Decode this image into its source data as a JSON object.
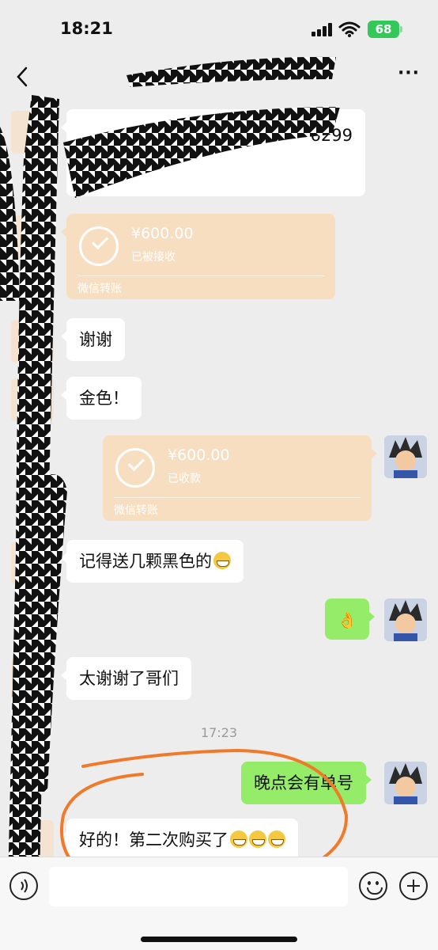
{
  "status_bar": {
    "time": "18:21",
    "battery": "68"
  },
  "nav": {
    "title": ""
  },
  "messages": [
    {
      "id": "m1",
      "dir": "in",
      "kind": "text",
      "text": "6299"
    },
    {
      "id": "m2",
      "dir": "in",
      "kind": "transfer",
      "amount": "¥600.00",
      "status": "已被接收",
      "label": "微信转账"
    },
    {
      "id": "m3",
      "dir": "in",
      "kind": "text",
      "text": "谢谢"
    },
    {
      "id": "m4",
      "dir": "in",
      "kind": "text",
      "text": "金色！"
    },
    {
      "id": "m5",
      "dir": "out",
      "kind": "transfer",
      "amount": "¥600.00",
      "status": "已收款",
      "label": "微信转账"
    },
    {
      "id": "m6",
      "dir": "in",
      "kind": "text",
      "text": "记得送几颗黑色的"
    },
    {
      "id": "m7",
      "dir": "out",
      "kind": "emoji",
      "text": "👌"
    },
    {
      "id": "m8",
      "dir": "in",
      "kind": "text",
      "text": "太谢谢了哥们"
    },
    {
      "id": "m9",
      "dir": "out",
      "kind": "text",
      "text": "晚点会有单号"
    },
    {
      "id": "m10",
      "dir": "in",
      "kind": "text",
      "text": "好的！第二次购买了"
    }
  ],
  "timestamp": "17:23",
  "input": {
    "placeholder": ""
  },
  "colors": {
    "incoming": "#ffffff",
    "outgoing": "#95ec69",
    "transfer": "#f8dec0",
    "background": "#ededed",
    "annotation": "#f07a2a"
  }
}
